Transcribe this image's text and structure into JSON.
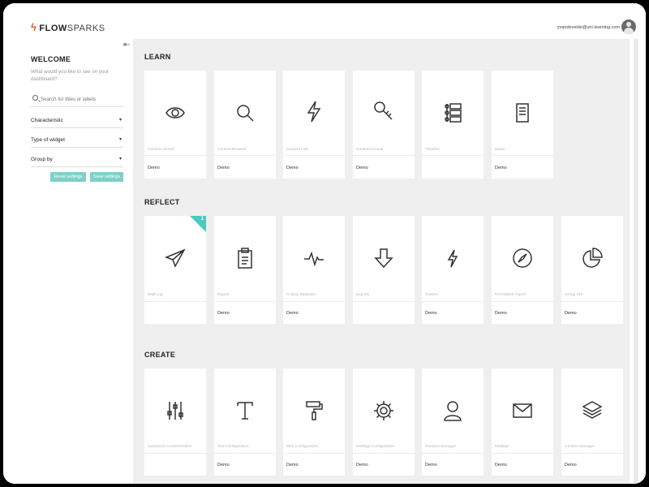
{
  "header": {
    "logo_flow": "FLOW",
    "logo_sparks": "SPARKS",
    "user_email": "yvandevelde@uni-learning.com"
  },
  "sidebar": {
    "welcome": "WELCOME",
    "intro": "What would you like to see on your dashboard?",
    "search_placeholder": "Search for titles or labels",
    "filters": [
      "Characteristic",
      "Type of widget",
      "Group by"
    ],
    "reset_label": "Reset settings",
    "save_label": "Save settings"
  },
  "sections": {
    "learn": {
      "title": "LEARN",
      "cards": [
        {
          "icon": "eye-icon",
          "name": "Content Viewer",
          "tag": "Demo"
        },
        {
          "icon": "search-icon",
          "name": "Content Browser",
          "tag": "Demo"
        },
        {
          "icon": "lightning-icon",
          "name": "Content Link",
          "tag": "Demo"
        },
        {
          "icon": "key-icon",
          "name": "Content Access",
          "tag": "Demo"
        },
        {
          "icon": "timeline-icon",
          "name": "Timeline",
          "tag": ""
        },
        {
          "icon": "document-icon",
          "name": "Notes",
          "tag": "Demo"
        }
      ]
    },
    "reflect": {
      "title": "REFLECT",
      "cards": [
        {
          "icon": "paper-plane-icon",
          "name": "Wall Log",
          "tag": "",
          "badge": "1"
        },
        {
          "icon": "clipboard-icon",
          "name": "Report",
          "tag": "Demo"
        },
        {
          "icon": "activity-icon",
          "name": "Activity Statistics",
          "tag": "Demo"
        },
        {
          "icon": "arrow-down-icon",
          "name": "Exports",
          "tag": ""
        },
        {
          "icon": "lightning-icon",
          "name": "Tracker",
          "tag": "Demo"
        },
        {
          "icon": "compass-icon",
          "name": "ROADMAP report",
          "tag": "Demo"
        },
        {
          "icon": "pie-chart-icon",
          "name": "Group KPI",
          "tag": "Demo"
        }
      ]
    },
    "create": {
      "title": "CREATE",
      "cards": [
        {
          "icon": "sliders-icon",
          "name": "Customize Customization",
          "tag": ""
        },
        {
          "icon": "text-icon",
          "name": "Text Configuration",
          "tag": "Demo"
        },
        {
          "icon": "paint-roller-icon",
          "name": "Skin Configuration",
          "tag": "Demo"
        },
        {
          "icon": "gear-icon",
          "name": "Settings Configuration",
          "tag": "Demo"
        },
        {
          "icon": "person-icon",
          "name": "Persona Manager",
          "tag": "Demo"
        },
        {
          "icon": "mail-icon",
          "name": "Mailings",
          "tag": "Demo"
        },
        {
          "icon": "layers-icon",
          "name": "Content Manager",
          "tag": "Demo"
        }
      ]
    }
  }
}
